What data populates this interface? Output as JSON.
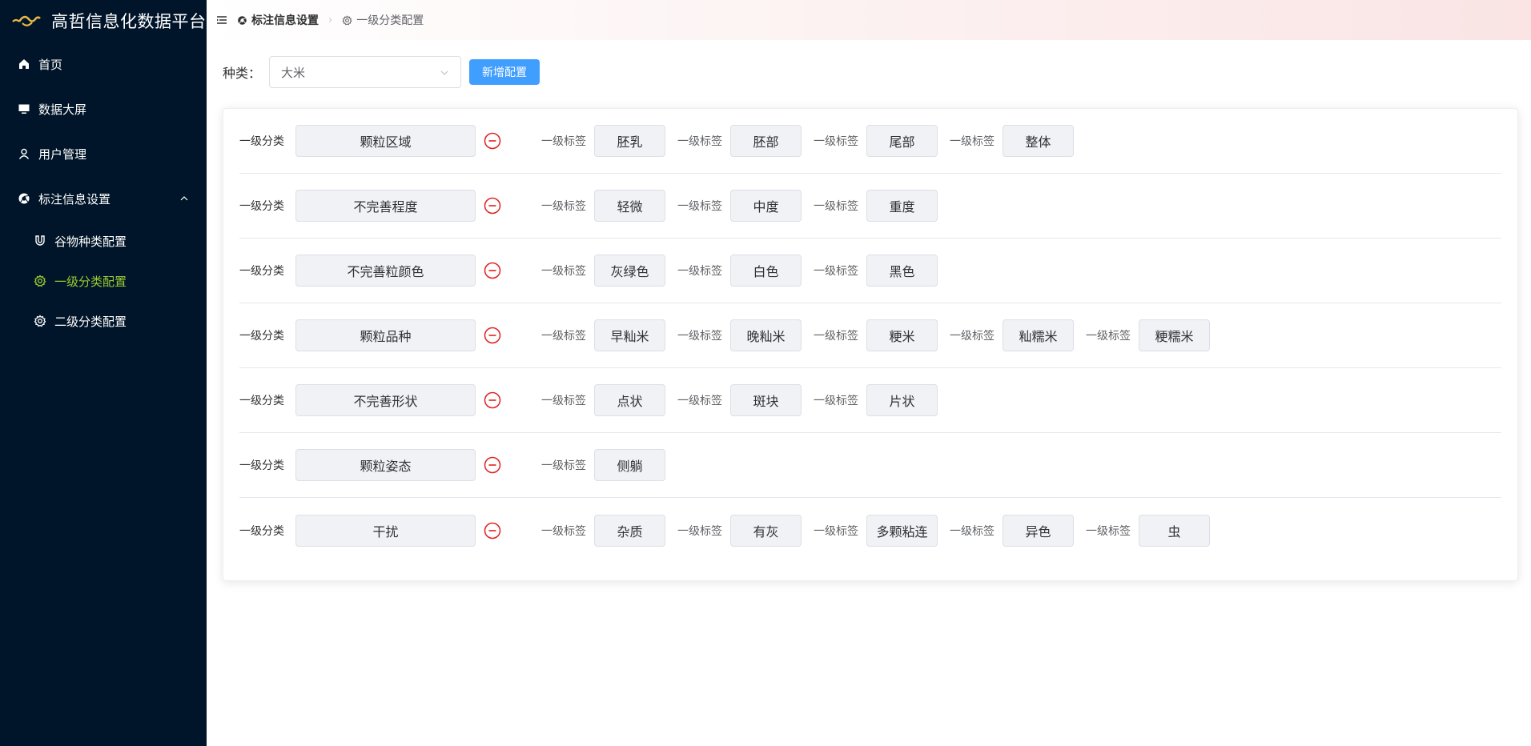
{
  "app": {
    "title": "高哲信息化数据平台",
    "accent_color": "#409eff",
    "active_menu_color": "#9acd32",
    "sidebar_bg": "#001529",
    "remove_icon_color": "#e02020"
  },
  "sidebar": {
    "items": [
      {
        "label": "首页",
        "icon": "home-icon"
      },
      {
        "label": "数据大屏",
        "icon": "monitor-icon"
      },
      {
        "label": "用户管理",
        "icon": "user-icon"
      },
      {
        "label": "标注信息设置",
        "icon": "chrome-icon",
        "expanded": true
      }
    ],
    "subitems": [
      {
        "label": "谷物种类配置",
        "icon": "magnet-icon",
        "active": false
      },
      {
        "label": "一级分类配置",
        "icon": "gear-icon",
        "active": true
      },
      {
        "label": "二级分类配置",
        "icon": "gear-icon",
        "active": false
      }
    ]
  },
  "header": {
    "breadcrumb": [
      {
        "label": "标注信息设置",
        "icon": "chrome-icon"
      },
      {
        "label": "一级分类配置",
        "icon": "gear-icon"
      }
    ]
  },
  "toolbar": {
    "type_label": "种类：",
    "type_selected": "大米",
    "add_button": "新增配置"
  },
  "config": {
    "category_label": "一级分类",
    "tag_label": "一级标签",
    "rows": [
      {
        "category": "颗粒区域",
        "tags": [
          "胚乳",
          "胚部",
          "尾部",
          "整体"
        ]
      },
      {
        "category": "不完善程度",
        "tags": [
          "轻微",
          "中度",
          "重度"
        ]
      },
      {
        "category": "不完善粒颜色",
        "tags": [
          "灰绿色",
          "白色",
          "黑色"
        ]
      },
      {
        "category": "颗粒品种",
        "tags": [
          "早籼米",
          "晚籼米",
          "粳米",
          "籼糯米",
          "粳糯米"
        ]
      },
      {
        "category": "不完善形状",
        "tags": [
          "点状",
          "斑块",
          "片状"
        ]
      },
      {
        "category": "颗粒姿态",
        "tags": [
          "侧躺"
        ]
      },
      {
        "category": "干扰",
        "tags": [
          "杂质",
          "有灰",
          "多颗粘连",
          "异色",
          "虫"
        ]
      }
    ]
  }
}
